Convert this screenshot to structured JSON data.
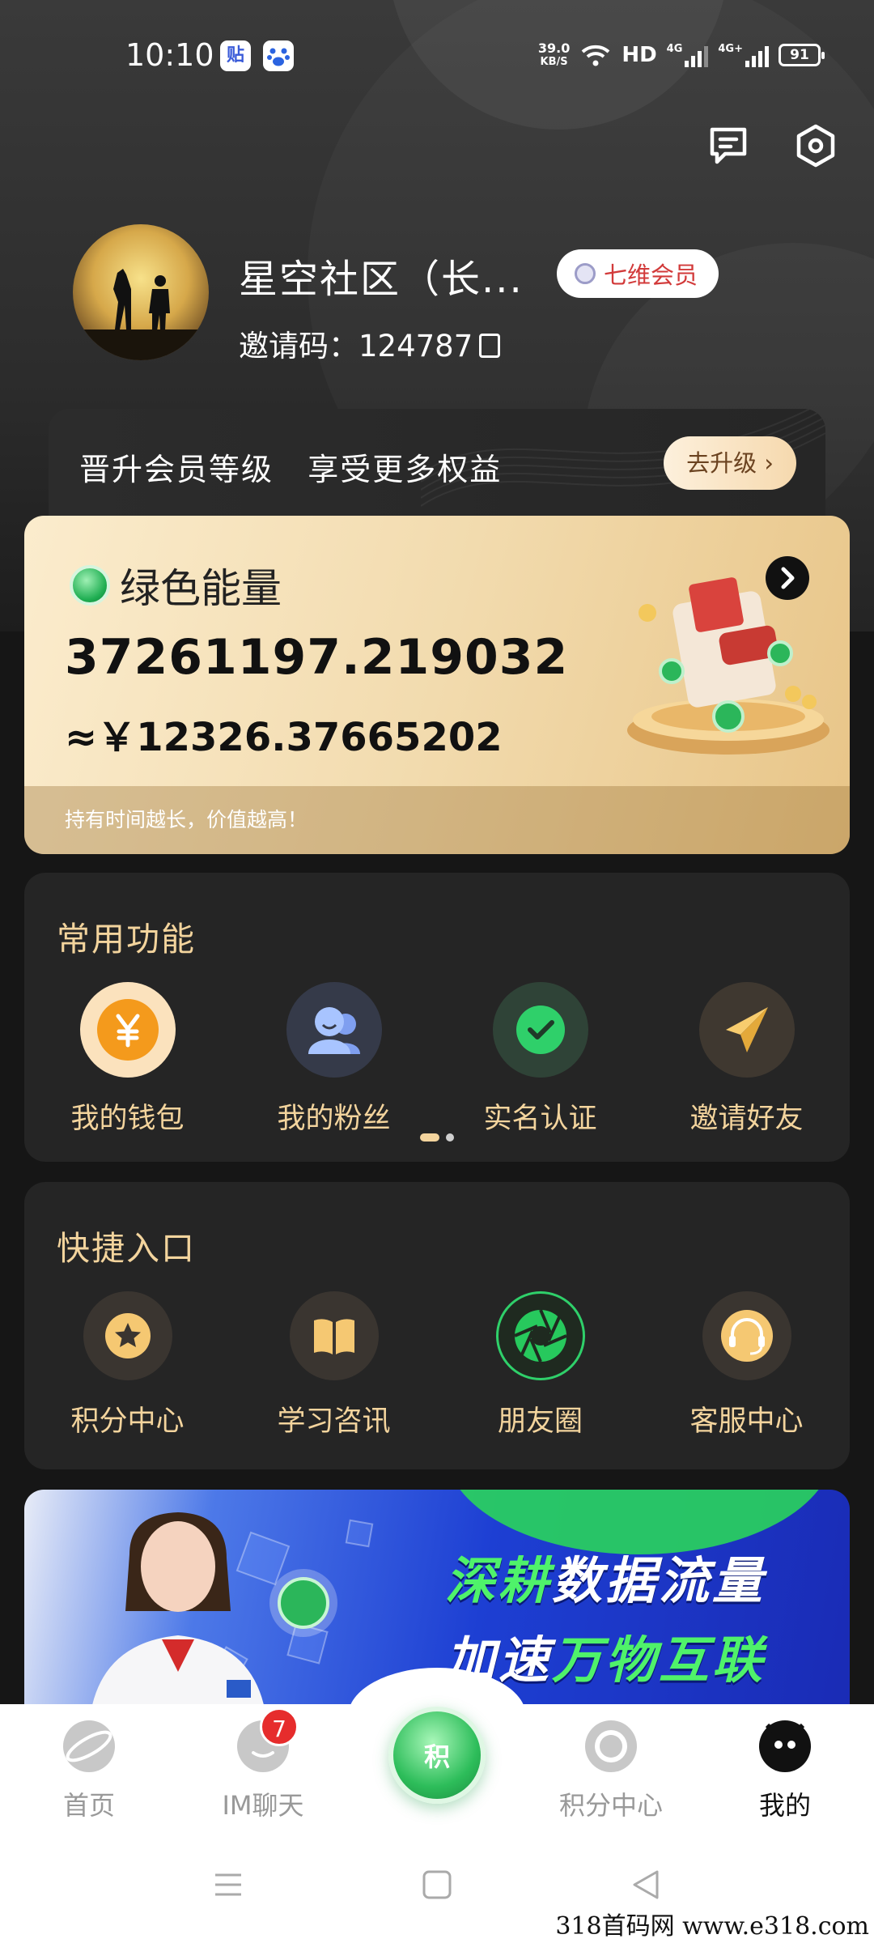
{
  "status_bar": {
    "time": "10:10",
    "app_icon_1": "贴",
    "speed_value": "39.0",
    "speed_unit": "KB/S",
    "hd": "HD",
    "net1": "4G",
    "net2": "4G+",
    "battery": "91"
  },
  "profile": {
    "name": "星空社区（长...",
    "vip_label": "七维会员",
    "invite_text": "邀请码：124787"
  },
  "upgrade": {
    "text": "晋升会员等级   享受更多权益",
    "button": "去升级 ›"
  },
  "energy": {
    "title": "绿色能量",
    "value": "37261197.219032",
    "cny": "≈￥12326.37665202",
    "footer": "持有时间越长，价值越高！"
  },
  "common_functions": {
    "title": "常用功能",
    "items": [
      {
        "label": "我的钱包",
        "icon": "wallet-yuan-icon"
      },
      {
        "label": "我的粉丝",
        "icon": "fans-icon"
      },
      {
        "label": "实名认证",
        "icon": "verified-check-icon"
      },
      {
        "label": "邀请好友",
        "icon": "paper-plane-icon"
      }
    ],
    "page_indicator": {
      "total": 2,
      "active": 1
    }
  },
  "quick_entry": {
    "title": "快捷入口",
    "items": [
      {
        "label": "积分中心",
        "icon": "star-icon"
      },
      {
        "label": "学习咨讯",
        "icon": "book-icon"
      },
      {
        "label": "朋友圈",
        "icon": "moments-aperture-icon"
      },
      {
        "label": "客服中心",
        "icon": "headset-icon"
      }
    ]
  },
  "banner": {
    "line1_a": "深耕",
    "line1_b": "数据流量",
    "line2_a": "加速",
    "line2_b": "万物互联"
  },
  "tabbar": {
    "items": [
      {
        "label": "首页",
        "icon": "planet-icon"
      },
      {
        "label": "IM聊天",
        "icon": "chat-icon",
        "badge": "7"
      },
      {
        "label": "积",
        "icon": "center-points-icon"
      },
      {
        "label": "积分中心",
        "icon": "points-icon"
      },
      {
        "label": "我的",
        "icon": "me-icon",
        "active": true
      }
    ]
  },
  "colors": {
    "accent_gold": "#f3d49d",
    "card_bg": "#252525",
    "active_tab": "#111111",
    "badge_red": "#e62c2c"
  },
  "watermark": "318首码网  www.e318.com"
}
